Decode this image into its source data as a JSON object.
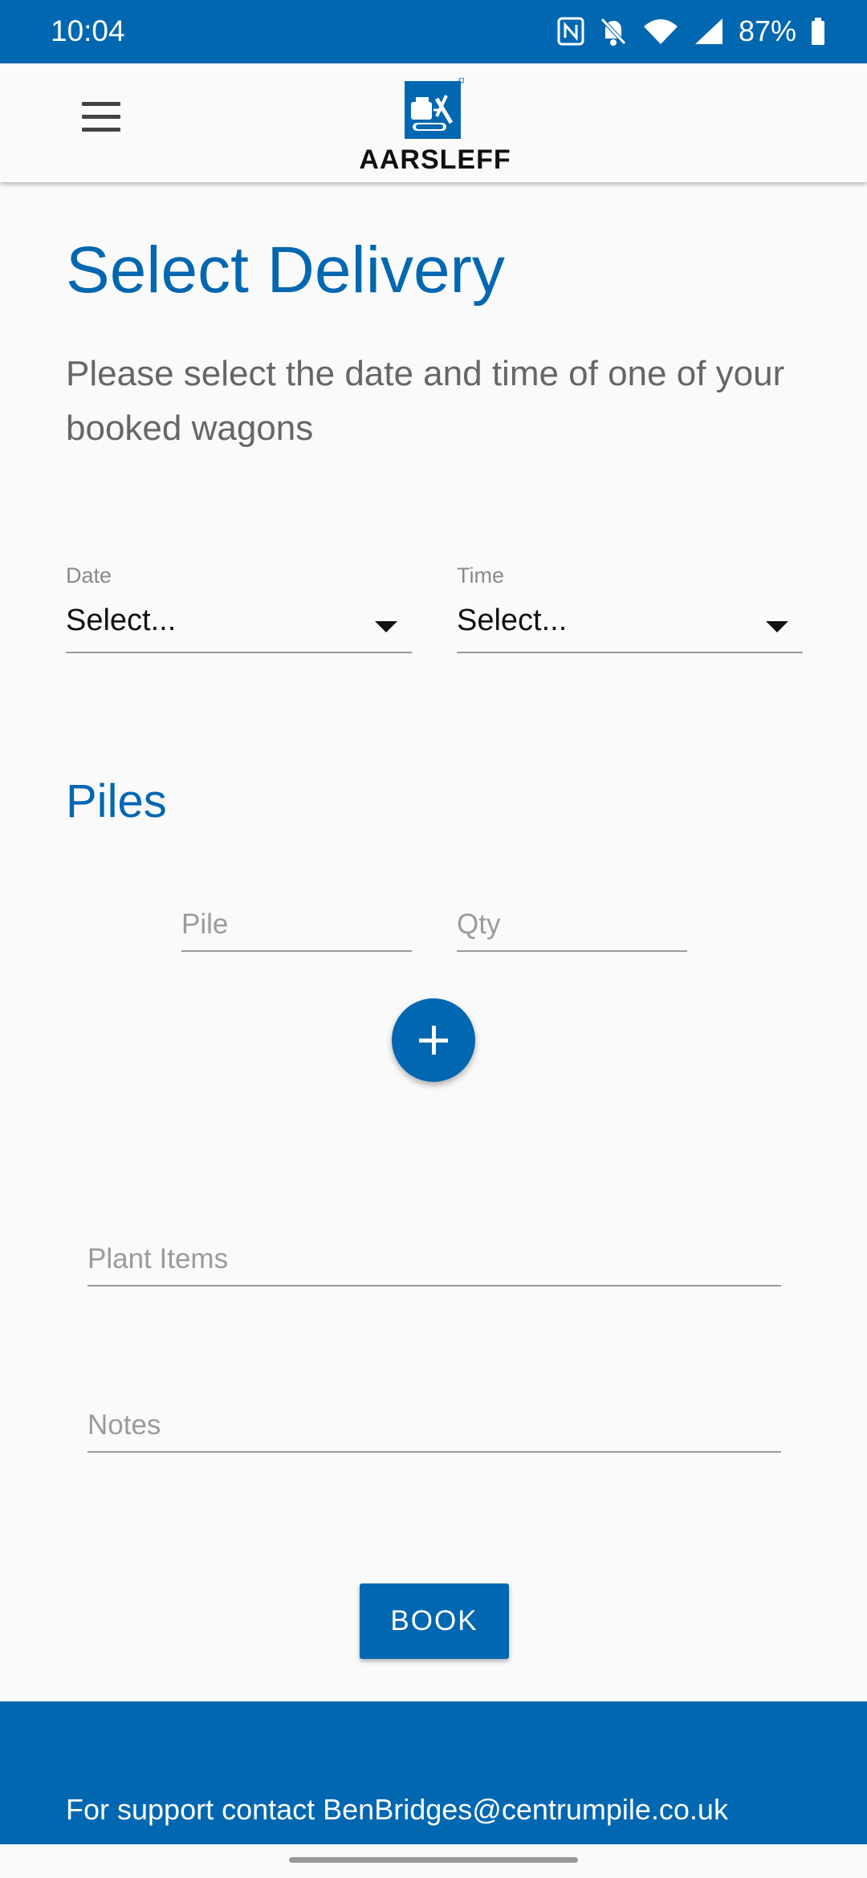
{
  "status_bar": {
    "time": "10:04",
    "battery": "87%",
    "icons": [
      "nfc-icon",
      "bell-off-icon",
      "wifi-icon",
      "signal-icon",
      "battery-icon"
    ]
  },
  "header": {
    "logo_text": "AARSLEFF",
    "menu_icon": "hamburger-menu-icon"
  },
  "main": {
    "title": "Select Delivery",
    "subtitle": "Please select the date and time of one of your booked wagons",
    "date": {
      "label": "Date",
      "value": "Select..."
    },
    "time": {
      "label": "Time",
      "value": "Select..."
    },
    "piles": {
      "title": "Piles",
      "pile_placeholder": "Pile",
      "qty_placeholder": "Qty",
      "add_icon": "plus-icon"
    },
    "plant_items_placeholder": "Plant Items",
    "notes_placeholder": "Notes",
    "book_label": "BOOK"
  },
  "footer": {
    "support_text": "For support contact BenBridges@centrumpile.co.uk"
  },
  "colors": {
    "brand": "#0167b1",
    "background": "#fafafa"
  }
}
